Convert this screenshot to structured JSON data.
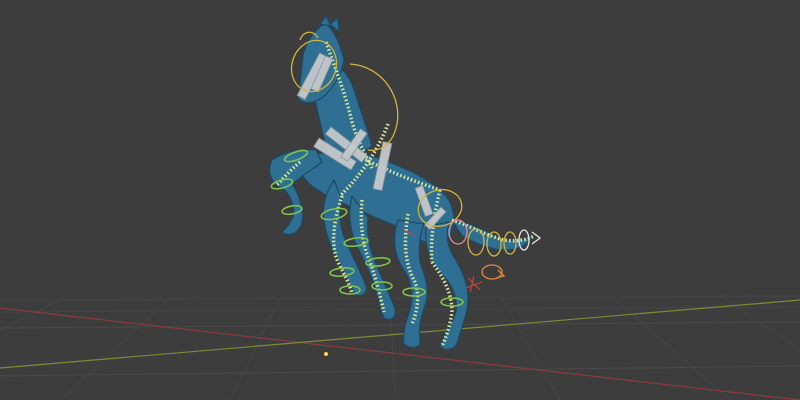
{
  "viewport": {
    "background": "#3d3d3d",
    "grid_color": "#4a4a4a",
    "axis_x_color": "#8a3a44",
    "axis_y_color": "#7c8a36"
  },
  "object": {
    "mesh_color": "#2f6f93",
    "rig_chain_color": "#d6e69a",
    "bone_color": "#c4c9cc"
  },
  "controls": {
    "colors": [
      "#d4b43a",
      "#7ec34a",
      "#e08a3a",
      "#e08a9a",
      "#e6e6e6",
      "#c7453c"
    ]
  },
  "icons": [
    "origin-icon"
  ]
}
